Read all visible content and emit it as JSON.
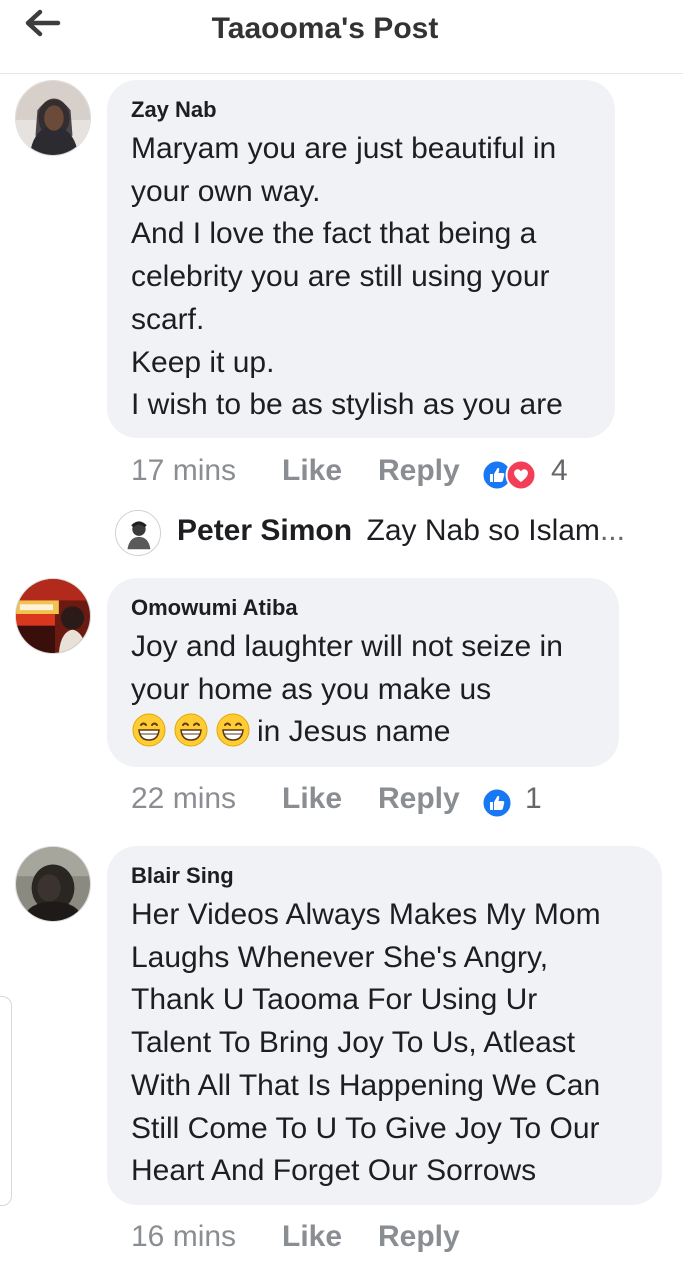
{
  "header": {
    "title": "Taaooma's Post",
    "back_icon": "arrow-left-icon"
  },
  "comments": [
    {
      "author": "Zay Nab",
      "lines": [
        "Maryam you are just beautiful in",
        "your own way.",
        "And I love the fact that being a",
        "celebrity you are still using your",
        "scarf.",
        "Keep it up.",
        "I wish to be as stylish as you are"
      ],
      "time": "17 mins",
      "like": "Like",
      "reply": "Reply",
      "reaction_count": "4",
      "reactions": [
        "like-icon",
        "love-icon"
      ]
    },
    {
      "author": "Omowumi Atiba",
      "lines": [
        "Joy and laughter will not seize in",
        "your home as you make us",
        "in Jesus name"
      ],
      "emoji": "grinning-face-icon",
      "time": "22 mins",
      "like": "Like",
      "reply": "Reply",
      "reaction_count": "1",
      "reactions": [
        "like-icon"
      ]
    },
    {
      "author": "Blair Sing",
      "lines": [
        "Her Videos Always Makes My Mom",
        "Laughs Whenever She's Angry,",
        "Thank U Taooma For Using Ur",
        "Talent To Bring Joy To Us, Atleast",
        "With All That Is Happening We Can",
        "Still Come To U To Give Joy To Our",
        "Heart And Forget Our Sorrows"
      ],
      "time": "16 mins",
      "like": "Like",
      "reply": "Reply"
    }
  ],
  "reply_preview": {
    "author": "Peter Simon",
    "text": "Zay Nab so Islam",
    "ellipsis": "..."
  },
  "colors": {
    "bubble": "#f0f2f5",
    "meta_text": "#8a8d91",
    "like_blue": "#1877f2",
    "love_red": "#f33e58"
  }
}
